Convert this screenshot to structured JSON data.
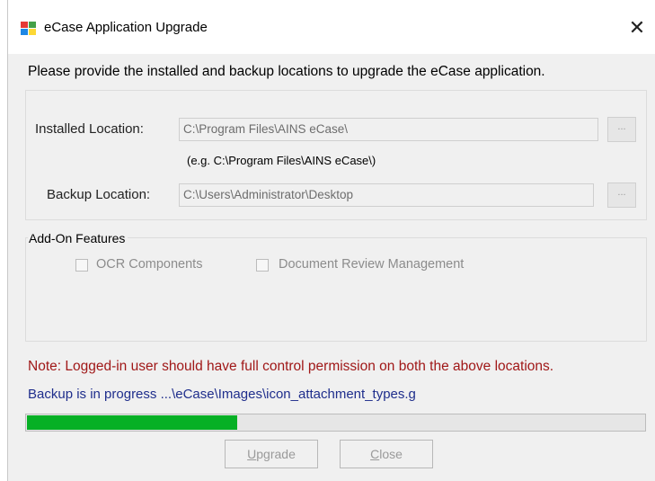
{
  "window": {
    "title": "eCase Application Upgrade",
    "close_glyph": "✕"
  },
  "instructions": "Please provide the installed and backup locations to upgrade the eCase application.",
  "installed": {
    "label": "Installed Location:",
    "value": "C:\\Program Files\\AINS eCase\\",
    "browse_label": "...",
    "example": "(e.g. C:\\Program Files\\AINS eCase\\)"
  },
  "backup": {
    "label": "Backup Location:",
    "value": "C:\\Users\\Administrator\\Desktop",
    "browse_label": "..."
  },
  "addon": {
    "title": "Add-On Features",
    "options": [
      {
        "label": "OCR Components",
        "checked": false,
        "enabled": false
      },
      {
        "label": "Document Review Management",
        "checked": false,
        "enabled": false
      }
    ]
  },
  "note": "Note: Logged-in user should have full control permission on both the above locations.",
  "progress": {
    "text": "Backup is in progress ...\\eCase\\Images\\icon_attachment_types.g",
    "fraction": 0.34,
    "color": "#06b025"
  },
  "buttons": {
    "upgrade_prefix": "",
    "upgrade_ul": "U",
    "upgrade_rest": "pgrade",
    "close_ul": "C",
    "close_rest": "lose"
  },
  "icons": {
    "app": "app-window-icon",
    "close": "close-icon",
    "checkbox": "checkbox-icon"
  }
}
